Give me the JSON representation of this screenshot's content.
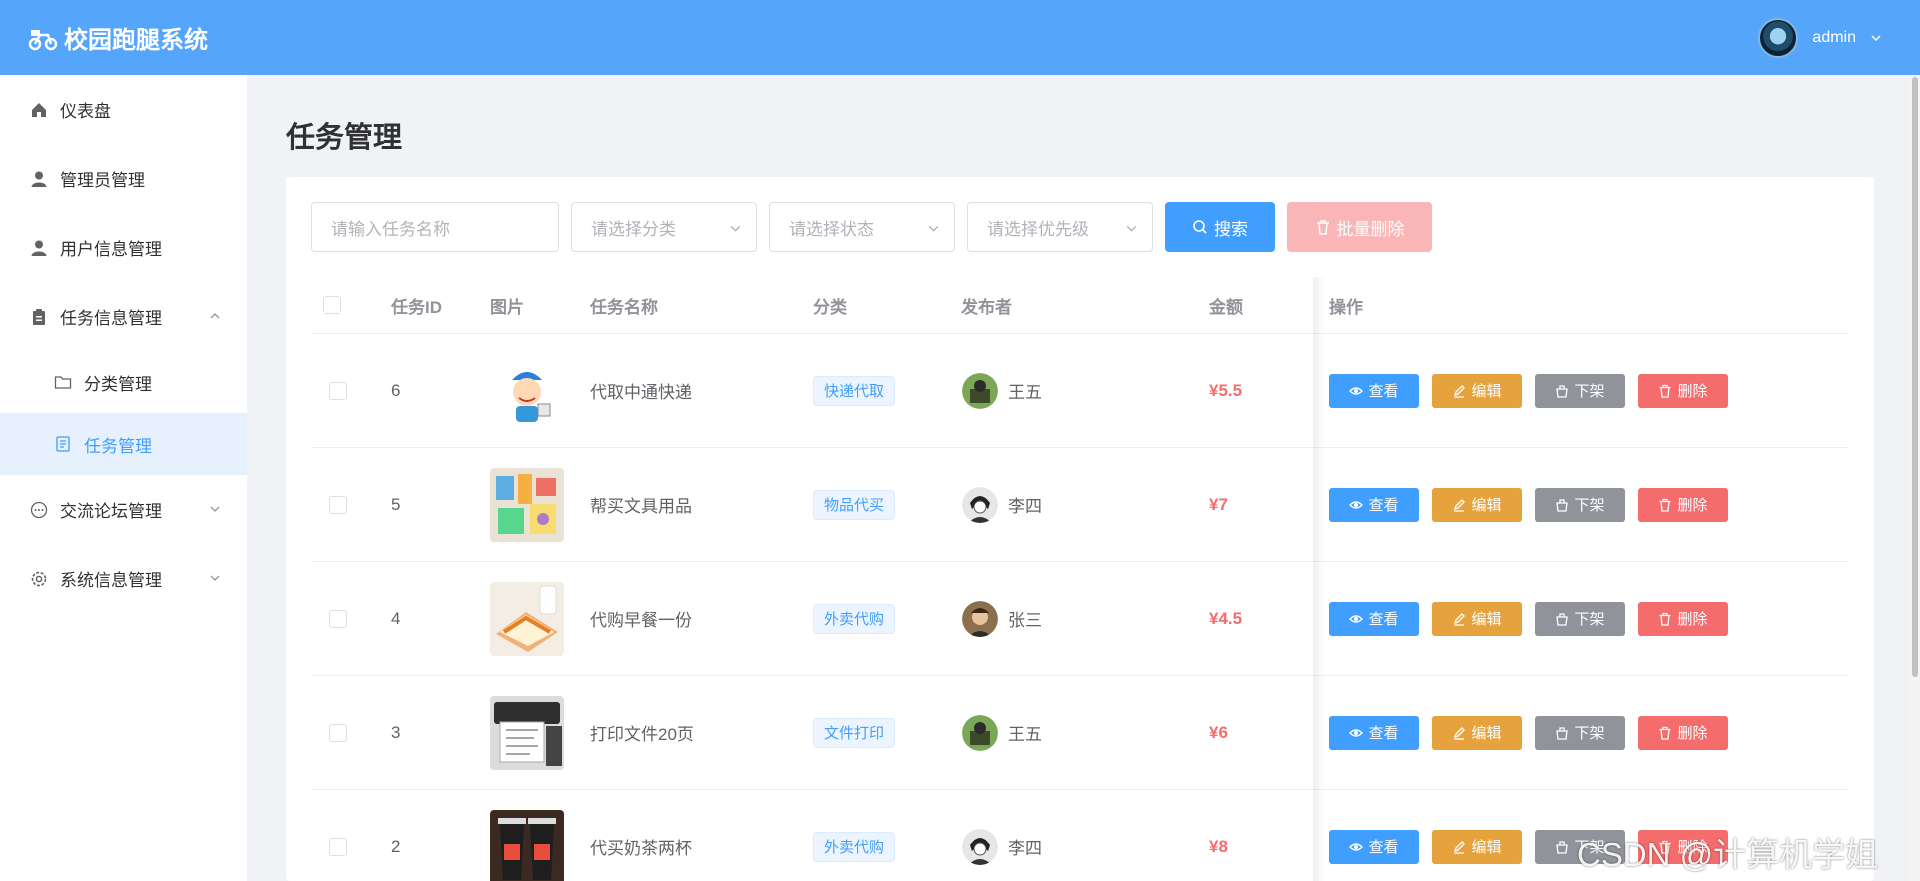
{
  "header": {
    "brand_title": "校园跑腿系统",
    "user_name": "admin"
  },
  "sidebar": {
    "items": [
      {
        "label": "仪表盘"
      },
      {
        "label": "管理员管理"
      },
      {
        "label": "用户信息管理"
      },
      {
        "label": "任务信息管理"
      },
      {
        "label": "交流论坛管理"
      },
      {
        "label": "系统信息管理"
      }
    ],
    "sub_items": [
      {
        "label": "分类管理"
      },
      {
        "label": "任务管理"
      }
    ]
  },
  "page": {
    "title": "任务管理"
  },
  "toolbar": {
    "name_placeholder": "请输入任务名称",
    "category_placeholder": "请选择分类",
    "status_placeholder": "请选择状态",
    "priority_placeholder": "请选择优先级",
    "search_label": "搜索",
    "bulk_delete_label": "批量删除"
  },
  "table": {
    "columns": [
      "任务ID",
      "图片",
      "任务名称",
      "分类",
      "发布者",
      "金额",
      "操作"
    ],
    "action_labels": {
      "view": "查看",
      "edit": "编辑",
      "offline": "下架",
      "delete": "删除"
    },
    "rows": [
      {
        "id": "6",
        "name": "代取中通快递",
        "category": "快递代取",
        "publisher": "王五",
        "amount": "¥5.5"
      },
      {
        "id": "5",
        "name": "帮买文具用品",
        "category": "物品代买",
        "publisher": "李四",
        "amount": "¥7"
      },
      {
        "id": "4",
        "name": "代购早餐一份",
        "category": "外卖代购",
        "publisher": "张三",
        "amount": "¥4.5"
      },
      {
        "id": "3",
        "name": "打印文件20页",
        "category": "文件打印",
        "publisher": "王五",
        "amount": "¥6"
      },
      {
        "id": "2",
        "name": "代买奶茶两杯",
        "category": "外卖代购",
        "publisher": "李四",
        "amount": "¥8"
      }
    ]
  },
  "watermark": "CSDN @计算机学姐",
  "colors": {
    "primary": "#409eff",
    "header": "#55a5fa",
    "danger": "#f56c6c",
    "warning": "#e6a23c",
    "info": "#909399"
  }
}
